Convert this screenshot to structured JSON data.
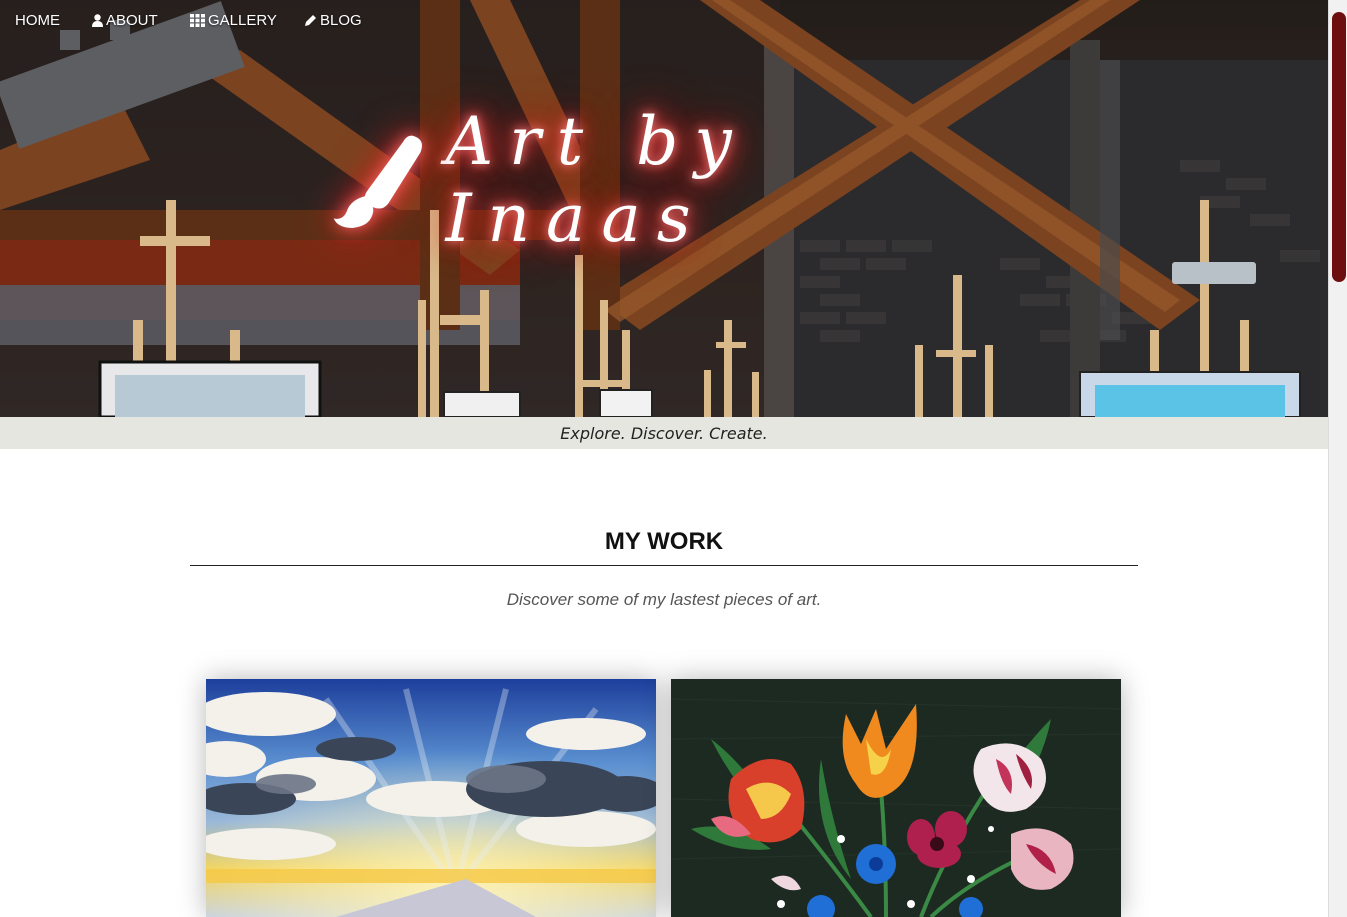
{
  "nav": {
    "items": [
      {
        "label": "HOME",
        "icon": ""
      },
      {
        "label": "ABOUT",
        "icon": "user-icon"
      },
      {
        "label": "GALLERY",
        "icon": "grid-icon"
      },
      {
        "label": "BLOG",
        "icon": "pencil-icon"
      }
    ]
  },
  "hero": {
    "title": "Art by Inaas",
    "logo_icon": "paintbrush-icon",
    "glow_color": "#e02020"
  },
  "tagline": "Explore. Discover. Create.",
  "section": {
    "title": "MY WORK",
    "subtitle": "Discover some of my lastest pieces of art."
  },
  "artworks": [
    {
      "subject": "sky-painting-image"
    },
    {
      "subject": "flower-painting-image"
    }
  ],
  "colors": {
    "tagline_bg": "#e5e6e0",
    "scroll_thumb": "#6e0f0f"
  }
}
